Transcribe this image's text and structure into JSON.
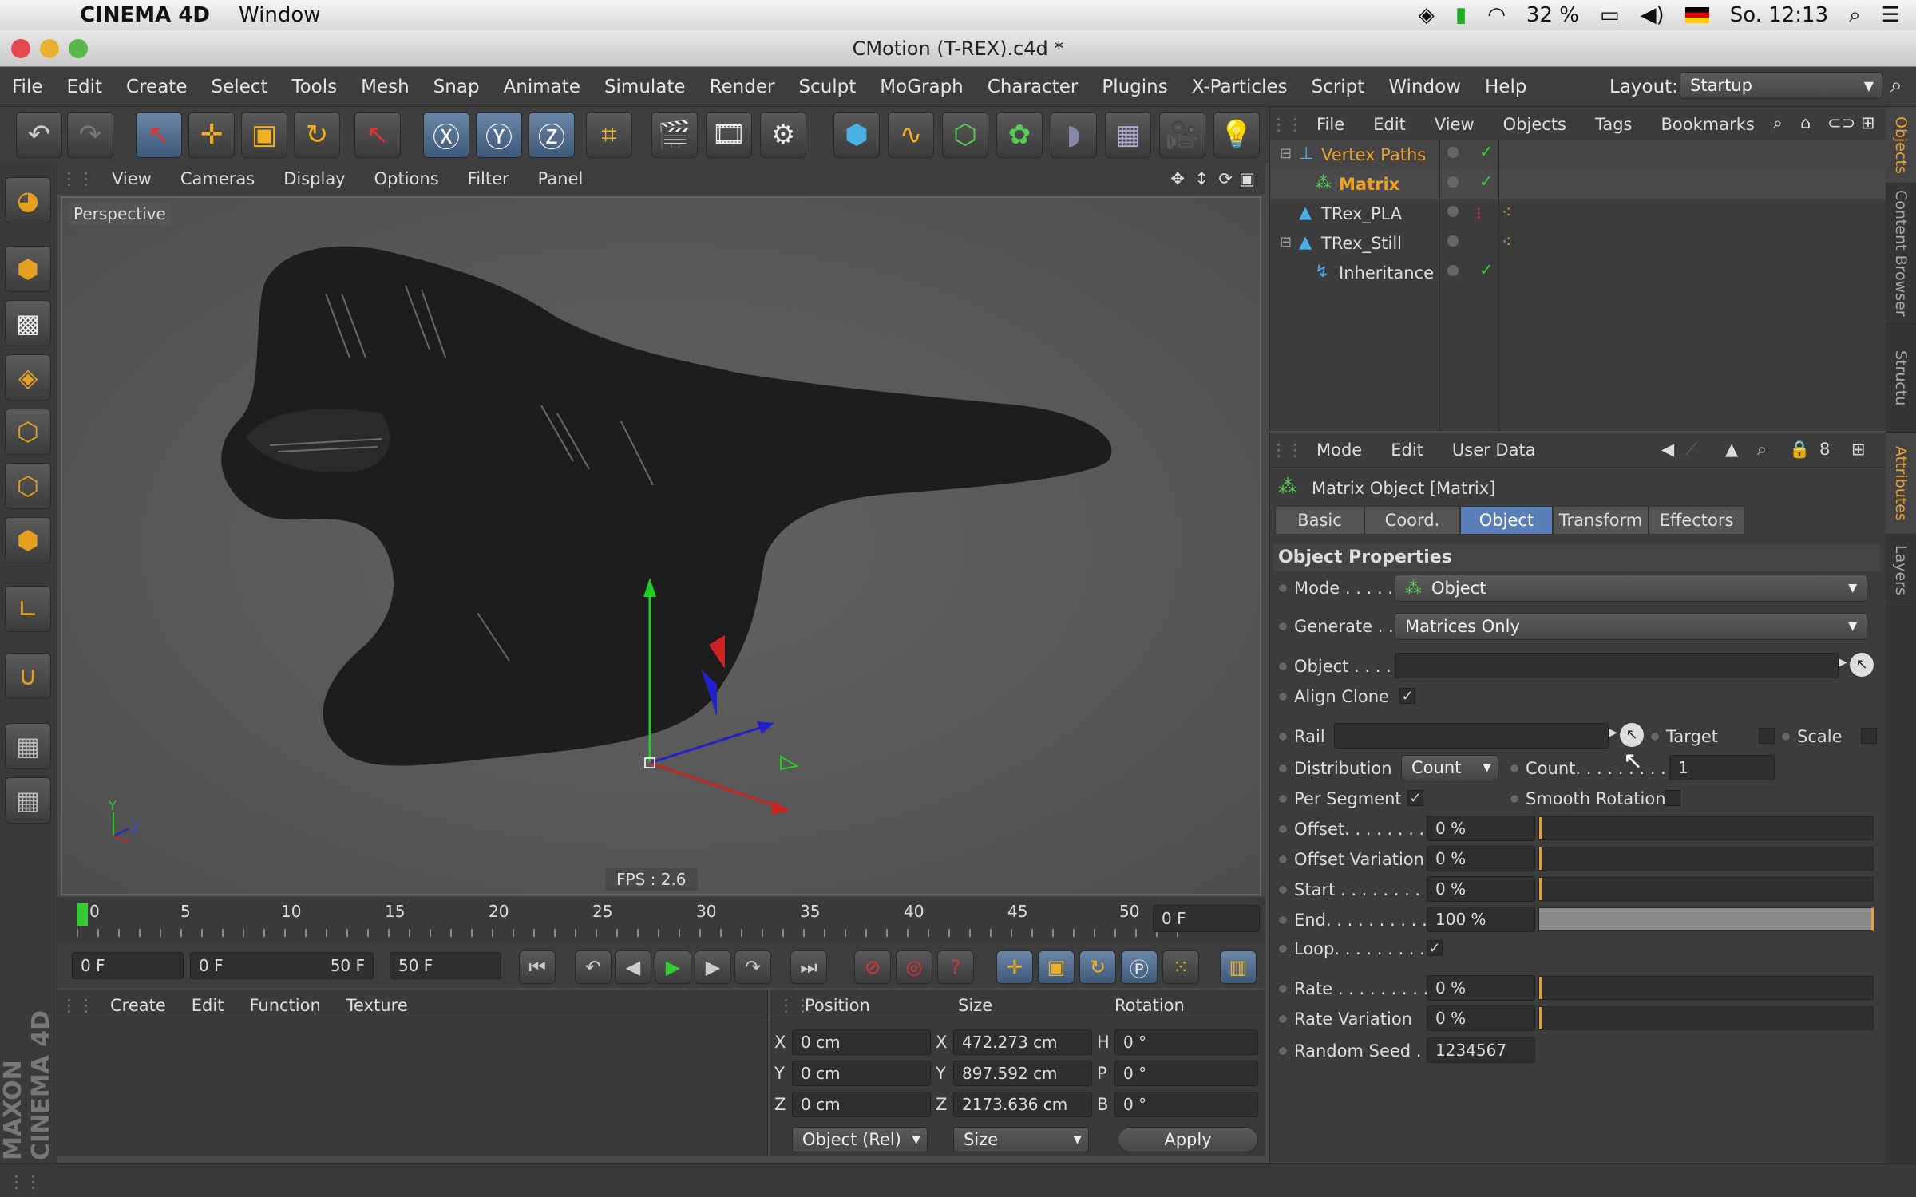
{
  "macos": {
    "app_name": "CINEMA 4D",
    "menu_window": "Window",
    "battery": "32 %",
    "clock": "So. 12:13"
  },
  "window": {
    "title": "CMotion (T-REX).c4d *"
  },
  "app_menu": {
    "items": [
      "File",
      "Edit",
      "Create",
      "Select",
      "Tools",
      "Mesh",
      "Snap",
      "Animate",
      "Simulate",
      "Render",
      "Sculpt",
      "MoGraph",
      "Character",
      "Plugins",
      "X-Particles",
      "Script",
      "Window",
      "Help"
    ],
    "layout_label": "Layout:",
    "layout_value": "Startup"
  },
  "viewport": {
    "menu": [
      "View",
      "Cameras",
      "Display",
      "Options",
      "Filter",
      "Panel"
    ],
    "label": "Perspective",
    "fps": "FPS : 2.6",
    "axis_y": "Y",
    "axis_z": "Z"
  },
  "timeline": {
    "ticks": [
      "0",
      "5",
      "10",
      "15",
      "20",
      "25",
      "30",
      "35",
      "40",
      "45",
      "50"
    ],
    "current_frame": "0 F"
  },
  "controls": {
    "start": "0 F",
    "range_start": "0 F",
    "range_end": "50 F",
    "end": "50 F"
  },
  "material_panel": {
    "menu": [
      "Create",
      "Edit",
      "Function",
      "Texture"
    ]
  },
  "coord_panel": {
    "headers": [
      "Position",
      "Size",
      "Rotation"
    ],
    "rows": [
      {
        "axis": "X",
        "pos": "0 cm",
        "size_axis": "X",
        "size": "472.273 cm",
        "rot_axis": "H",
        "rot": "0 °"
      },
      {
        "axis": "Y",
        "pos": "0 cm",
        "size_axis": "Y",
        "size": "897.592 cm",
        "rot_axis": "P",
        "rot": "0 °"
      },
      {
        "axis": "Z",
        "pos": "0 cm",
        "size_axis": "Z",
        "size": "2173.636 cm",
        "rot_axis": "B",
        "rot": "0 °"
      }
    ],
    "mode": "Object (Rel)",
    "size_mode": "Size",
    "apply": "Apply"
  },
  "object_manager": {
    "menu": [
      "File",
      "Edit",
      "View",
      "Objects",
      "Tags",
      "Bookmarks"
    ],
    "objects": [
      {
        "name": "Vertex Paths",
        "color": "#e8a030"
      },
      {
        "name": "Matrix",
        "color": "#f0a020"
      },
      {
        "name": "TRex_PLA",
        "color": "#dddddd"
      },
      {
        "name": "TRex_Still",
        "color": "#dddddd"
      },
      {
        "name": "Inheritance",
        "color": "#dddddd"
      }
    ]
  },
  "attributes": {
    "menu": [
      "Mode",
      "Edit",
      "User Data"
    ],
    "object_title": "Matrix Object [Matrix]",
    "tabs": [
      "Basic",
      "Coord.",
      "Object",
      "Transform",
      "Effectors"
    ],
    "section": "Object Properties",
    "mode_label": "Mode . . . . .",
    "mode_value": "Object",
    "generate_label": "Generate . .",
    "generate_value": "Matrices Only",
    "object_label": "Object . . . .",
    "align_clone_label": "Align Clone",
    "rail_label": "Rail",
    "target_label": "Target",
    "scale_label": "Scale",
    "distribution_label": "Distribution",
    "distribution_value": "Count",
    "count_label": "Count. . . . . . . . .",
    "count_value": "1",
    "per_segment_label": "Per Segment",
    "smooth_rotation_label": "Smooth Rotation",
    "offset_label": "Offset. . . . . . . . .",
    "offset_value": "0 %",
    "offset_var_label": "Offset Variation",
    "offset_var_value": "0 %",
    "start_label": "Start . . . . . . . . .",
    "start_value": "0 %",
    "end_label": "End. . . . . . . . . .",
    "end_value": "100 %",
    "loop_label": "Loop. . . . . . . . .",
    "rate_label": "Rate . . . . . . . . .",
    "rate_value": "0 %",
    "rate_var_label": "Rate Variation",
    "rate_var_value": "0 %",
    "seed_label": "Random Seed . .",
    "seed_value": "1234567"
  },
  "side_tabs": [
    "Objects",
    "Content Browser",
    "Structu",
    "Attributes",
    "Layers"
  ],
  "brand": "MAXON CINEMA 4D"
}
